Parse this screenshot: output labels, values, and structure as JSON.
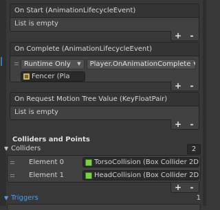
{
  "events": [
    {
      "title": "On Start (AnimationLifecycleEvent)",
      "empty_text": "List is empty"
    },
    {
      "title": "On Complete (AnimationLifecycleEvent)",
      "runtime_label": "Runtime Only",
      "function_label": "Player.OnAnimationComplete",
      "object_label": "Fencer (Pla"
    },
    {
      "title": "On Request Motion Tree Value (KeyFloatPair)",
      "empty_text": "List is empty"
    }
  ],
  "list_buttons": {
    "plus": "+",
    "minus": "-"
  },
  "colliders_section": {
    "title": "Colliders and Points",
    "foldout_label": "Colliders",
    "count": "2",
    "elements": [
      {
        "label": "Element 0",
        "value": "TorsoCollision (Box Collider 2D)"
      },
      {
        "label": "Element 1",
        "value": "HeadCollision (Box Collider 2D)"
      }
    ]
  },
  "triggers_section": {
    "label": "Triggers",
    "count": "1"
  },
  "colors": {
    "accent": "#3a79bb",
    "triggers_text": "#5b9bdc",
    "collider_icon": "#7ccf4a"
  }
}
